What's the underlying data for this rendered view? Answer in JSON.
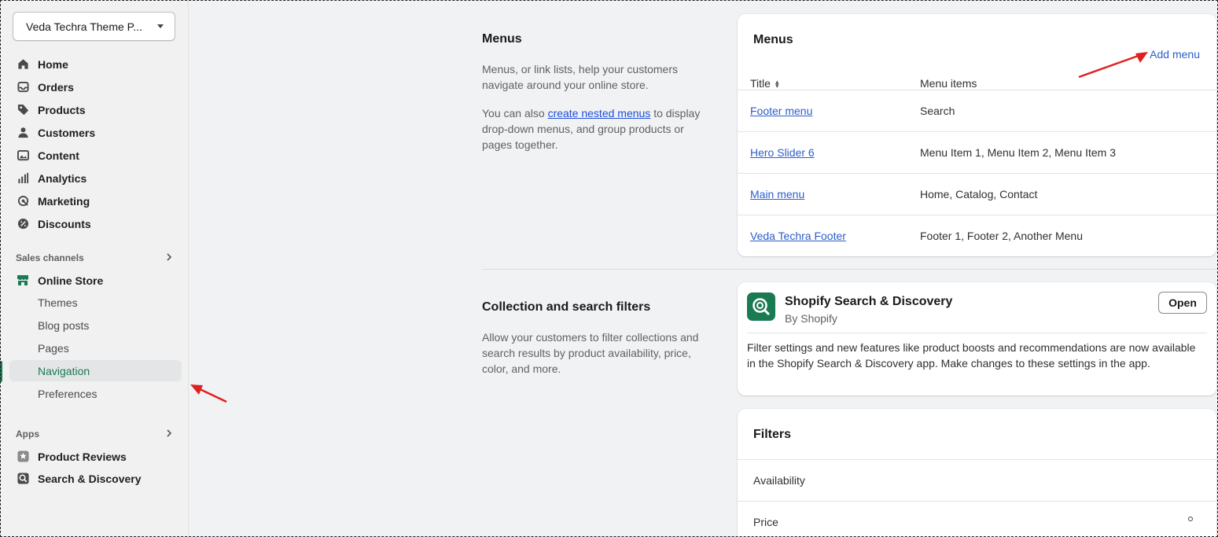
{
  "store_selector": {
    "label": "Veda Techra Theme P..."
  },
  "sidebar": {
    "main_items": [
      {
        "label": "Home",
        "icon": "home-icon"
      },
      {
        "label": "Orders",
        "icon": "inbox-icon"
      },
      {
        "label": "Products",
        "icon": "tag-icon"
      },
      {
        "label": "Customers",
        "icon": "person-icon"
      },
      {
        "label": "Content",
        "icon": "image-icon"
      },
      {
        "label": "Analytics",
        "icon": "bar-chart-icon"
      },
      {
        "label": "Marketing",
        "icon": "target-icon"
      },
      {
        "label": "Discounts",
        "icon": "discount-icon"
      }
    ],
    "sales_channels_label": "Sales channels",
    "online_store": {
      "label": "Online Store",
      "subitems": [
        "Themes",
        "Blog posts",
        "Pages",
        "Navigation",
        "Preferences"
      ],
      "active": "Navigation"
    },
    "apps_label": "Apps",
    "apps": [
      {
        "label": "Product Reviews",
        "icon": "star-icon"
      },
      {
        "label": "Search & Discovery",
        "icon": "search-discovery-icon"
      }
    ]
  },
  "menus_section": {
    "title": "Menus",
    "desc1": "Menus, or link lists, help your customers navigate around your online store.",
    "desc2_pre": "You can also ",
    "desc2_link": "create nested menus",
    "desc2_post": " to display drop-down menus, and group products or pages together."
  },
  "menus_card": {
    "title": "Menus",
    "add_menu": "Add menu",
    "col_title": "Title",
    "col_items": "Menu items",
    "rows": [
      {
        "title": "Footer menu",
        "items": "Search"
      },
      {
        "title": "Hero Slider 6",
        "items": "Menu Item 1, Menu Item 2, Menu Item 3"
      },
      {
        "title": "Main menu",
        "items": "Home, Catalog, Contact"
      },
      {
        "title": "Veda Techra Footer",
        "items": "Footer 1, Footer 2, Another Menu"
      }
    ]
  },
  "filters_section": {
    "title": "Collection and search filters",
    "desc": "Allow your customers to filter collections and search results by product availability, price, color, and more."
  },
  "app_card": {
    "name": "Shopify Search & Discovery",
    "by": "By Shopify",
    "open": "Open",
    "desc": "Filter settings and new features like product boosts and recommendations are now available in the Shopify Search & Discovery app. Make changes to these settings in the app."
  },
  "filters_card": {
    "title": "Filters",
    "rows": [
      "Availability",
      "Price"
    ]
  },
  "colors": {
    "accent_green": "#1a7a52",
    "link_blue": "#2c5ec9",
    "annotation_red": "#e02020"
  }
}
